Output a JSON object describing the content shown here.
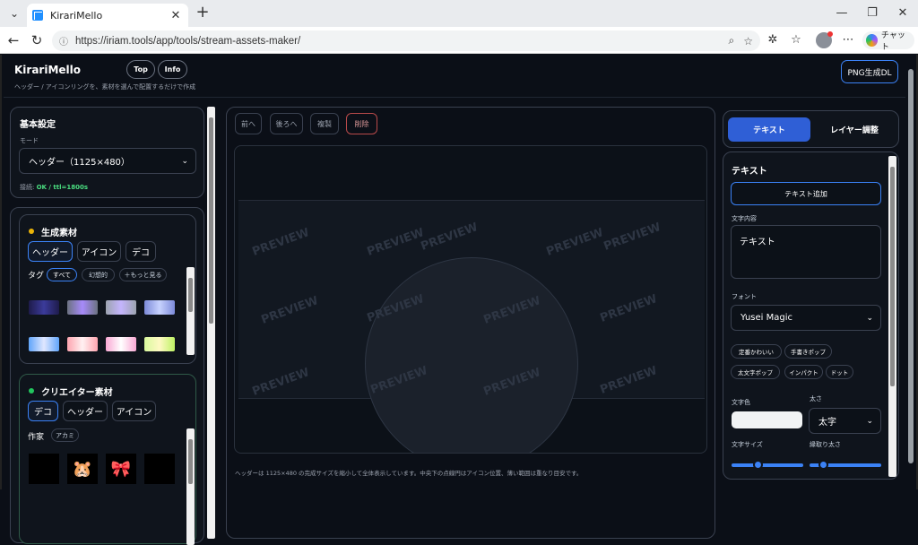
{
  "browser": {
    "tab_title": "KirariMello",
    "url": "https://iriam.tools/app/tools/stream-assets-maker/",
    "copilot_label": "チャット"
  },
  "app": {
    "brand": "KirariMello",
    "subtitle": "ヘッダー / アイコンリングを、素材を選んで配置するだけで作成",
    "nav": [
      "Top",
      "Info"
    ],
    "download": "PNG生成DL"
  },
  "basic": {
    "title": "基本設定",
    "mode_label": "モード",
    "mode_value": "ヘッダー（1125×480）",
    "status_prefix": "接続:",
    "status_value": "OK / ttl=1800s"
  },
  "generated": {
    "title": "生成素材",
    "tabs": [
      "ヘッダー",
      "アイコン",
      "デコ"
    ],
    "tag_label": "タグ",
    "tags": [
      "すべて",
      "幻想的",
      "＋もっと見る"
    ]
  },
  "creator": {
    "title": "クリエイター素材",
    "tabs": [
      "デコ",
      "ヘッダー",
      "アイコン"
    ],
    "author_label": "作家",
    "author": "アカミ"
  },
  "toolbar": {
    "buttons": [
      "前へ",
      "後ろへ",
      "複製",
      "削除"
    ]
  },
  "preview": {
    "watermark": "PREVIEW",
    "caption": "ヘッダーは 1125×480 の完成サイズを縮小して全体表示しています。中央下の点線円はアイコン位置、薄い範囲は重なり目安です。"
  },
  "right": {
    "tabs": [
      "テキスト",
      "レイヤー調整"
    ],
    "section_title": "テキスト",
    "add_text": "テキスト追加",
    "content_label": "文字内容",
    "content_value": "テキスト",
    "font_label": "フォント",
    "font_value": "Yusei Magic",
    "presets": [
      "定番かわいい",
      "手書きポップ",
      "太文字ポップ",
      "インパクト",
      "ドット"
    ],
    "color_label": "文字色",
    "weight_label": "太さ",
    "weight_value": "太字",
    "size_label": "文字サイズ",
    "stroke_label": "縁取り太さ",
    "size_slider": 0.35,
    "stroke_slider": 0.15
  },
  "colors": {
    "accent": "#3b82f6",
    "bg": "#0b0f17",
    "panel": "#0f141c"
  }
}
